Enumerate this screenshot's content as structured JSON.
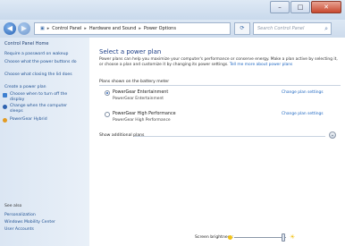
{
  "window": {
    "minimize_glyph": "–",
    "maximize_glyph": "□",
    "close_glyph": "✕"
  },
  "address_bar": {
    "crumbs": [
      "Control Panel",
      "Hardware and Sound",
      "Power Options"
    ],
    "search_placeholder": "Search Control Panel"
  },
  "sidebar": {
    "home_label": "Control Panel Home",
    "links": [
      "Require a password on wakeup",
      "Choose what the power buttons do",
      "Choose what closing the lid does",
      "Create a power plan",
      "Choose when to turn off the display",
      "Change when the computer sleeps",
      "PowerGear Hybrid"
    ],
    "see_also_label": "See also",
    "see_also_links": [
      "Personalization",
      "Windows Mobility Center",
      "User Accounts"
    ]
  },
  "main": {
    "heading": "Select a power plan",
    "description": "Power plans can help you maximize your computer's performance or conserve energy. Make a plan active by selecting it, or choose a plan and customize it by changing its power settings.",
    "description_link": "Tell me more about power plans",
    "section_label": "Plans shown on the battery meter",
    "plans": [
      {
        "name": "PowerGear Entertainment",
        "description": "PowerGear Entertainment",
        "selected": true,
        "settings_link": "Change plan settings"
      },
      {
        "name": "PowerGear High Performance",
        "description": "PowerGear High Performance",
        "selected": false,
        "settings_link": "Change plan settings"
      }
    ],
    "show_additional": "Show additional plans"
  },
  "brightness": {
    "label": "Screen brightness:",
    "level_fraction": 0.95
  }
}
